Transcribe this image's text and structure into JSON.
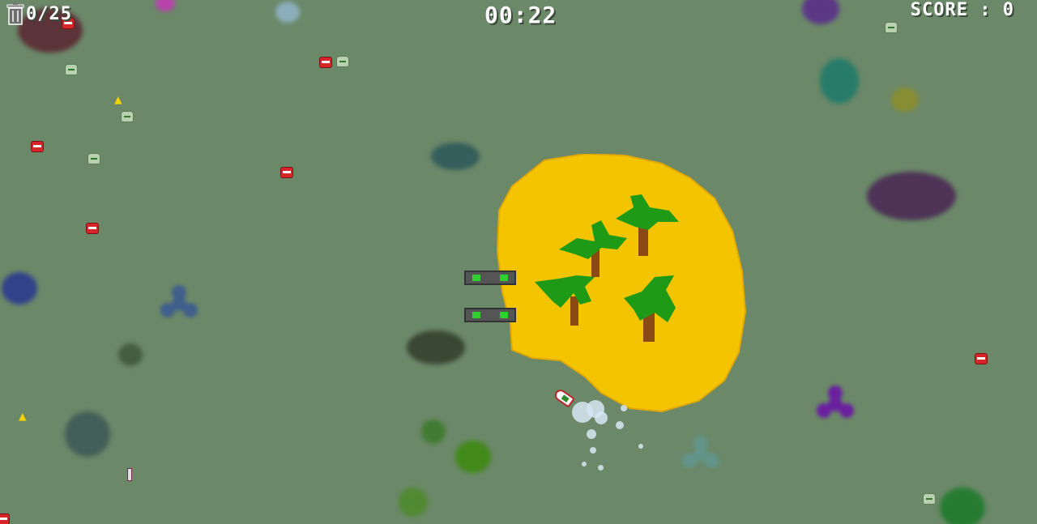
{
  "hud": {
    "trash_count": "0/25",
    "timer": "00:22",
    "score": "SCORE : 0"
  },
  "icons": {
    "trash": "trash-bin-icon",
    "can": "soda-can-icon",
    "jug": "plastic-jug-icon",
    "banana": "banana-peel-icon",
    "boat": "cleanup-boat-icon",
    "tree": "palm-tree-icon"
  },
  "colors": {
    "water": "#6b8868",
    "island": "#f5c400",
    "palm_leaf": "#1e9a16",
    "palm_trunk": "#8b4a14",
    "can": "#d7262a"
  }
}
